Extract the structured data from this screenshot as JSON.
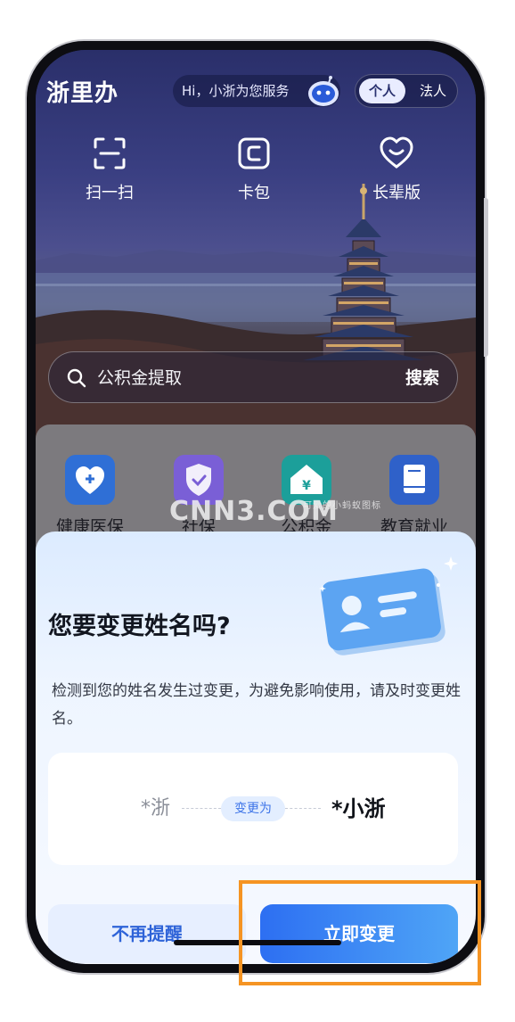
{
  "header": {
    "app_title": "浙里办",
    "greeting": "Hi，小浙为您服务",
    "role_personal": "个人",
    "role_legal": "法人"
  },
  "quick_actions": [
    {
      "label": "扫一扫",
      "icon": "scan-icon"
    },
    {
      "label": "卡包",
      "icon": "card-wallet-icon"
    },
    {
      "label": "长辈版",
      "icon": "heart-smile-icon"
    }
  ],
  "search": {
    "placeholder": "公积金提取",
    "button": "搜索"
  },
  "services": [
    {
      "label": "健康医保",
      "icon": "medical-heart-icon",
      "color": "#2f6fd6"
    },
    {
      "label": "社保",
      "icon": "shield-check-icon",
      "color": "#7a5fd6"
    },
    {
      "label": "公积金",
      "icon": "house-yuan-icon",
      "color": "#1c9f9a"
    },
    {
      "label": "教育就业",
      "icon": "book-icon",
      "color": "#2f61c9"
    }
  ],
  "watermark": {
    "text": "CNN3.COM",
    "small_text": "可爱的小蚂蚁图标"
  },
  "dialog": {
    "title": "您要变更姓名吗?",
    "description": "检测到您的姓名发生过变更，为避免影响使用，请及时变更姓名。",
    "old_name": "*浙",
    "change_label": "变更为",
    "new_name": "*小浙",
    "dismiss_button": "不再提醒",
    "confirm_button": "立即变更"
  },
  "colors": {
    "accent": "#2d6ff2",
    "highlight": "#f59423"
  }
}
